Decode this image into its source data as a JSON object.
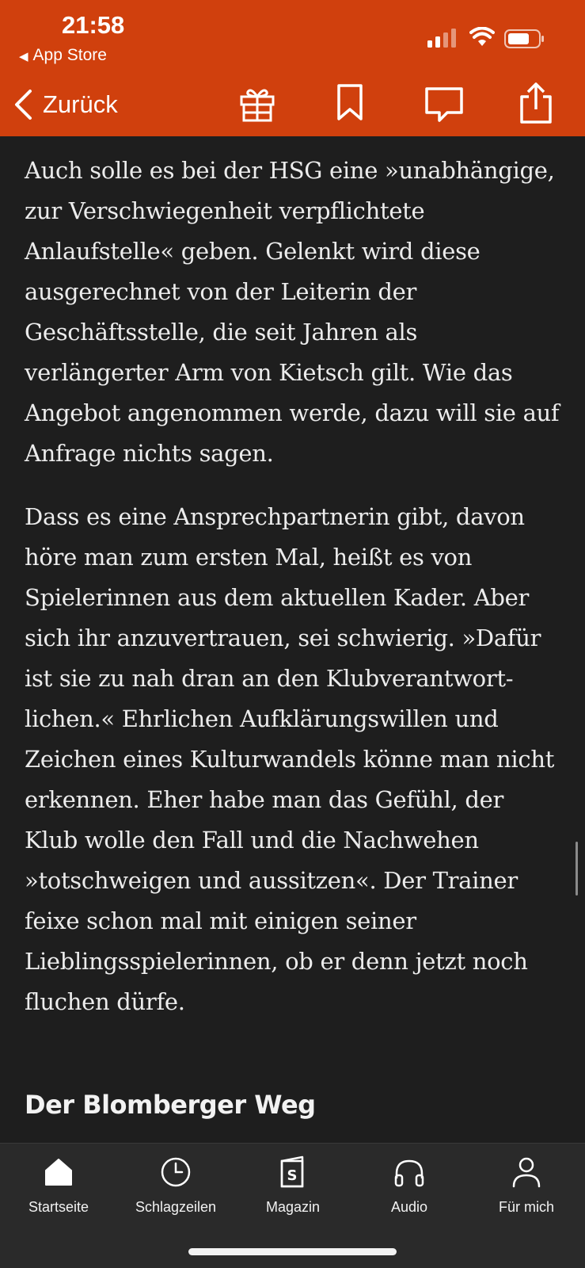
{
  "status_bar": {
    "time": "21:58",
    "back_app": "App Store"
  },
  "nav": {
    "back_label": "Zurück",
    "icons": [
      "gift-icon",
      "bookmark-icon",
      "comment-icon",
      "share-icon"
    ]
  },
  "article": {
    "paragraphs": [
      "Auch solle es bei der HSG eine »unabhängige, zur Verschwiegenheit verpflichtete Anlaufstelle« geben. Gelenkt wird diese ausgerechnet von der Leiterin der Geschäftsstelle, die seit Jahren als verlängerter Arm von Kietsch gilt. Wie das Angebot angenommen werde, dazu will sie auf Anfrage nichts sagen.",
      "Dass es eine Ansprechpartnerin gibt, davon höre man zum ersten Mal, heißt es von Spielerinnen aus dem aktuellen Kader. Aber sich ihr anzuvertrauen, sei schwierig. »Dafür ist sie zu nah dran an den Klubverantwort­lichen.« Ehrlichen Aufklärungswillen und Zeichen eines Kulturwandels könne man nicht erkennen. Eher habe man das Gefühl, der Klub wolle den Fall und die Nachwehen »totschweigen und aussitzen«. Der Trainer feixe schon mal mit einigen seiner Lieblingsspielerinnen, ob er denn jetzt noch fluchen dürfe."
    ],
    "subheading": "Der Blomberger Weg"
  },
  "tabbar": {
    "tabs": [
      {
        "label": "Startseite",
        "icon": "home-icon"
      },
      {
        "label": "Schlagzeilen",
        "icon": "clock-icon"
      },
      {
        "label": "Magazin",
        "icon": "magazine-icon"
      },
      {
        "label": "Audio",
        "icon": "headphones-icon"
      },
      {
        "label": "Für mich",
        "icon": "person-icon"
      }
    ]
  },
  "colors": {
    "header_orange": "#d0400d",
    "background": "#1e1e1e",
    "tabbar": "#2a2a2a"
  }
}
